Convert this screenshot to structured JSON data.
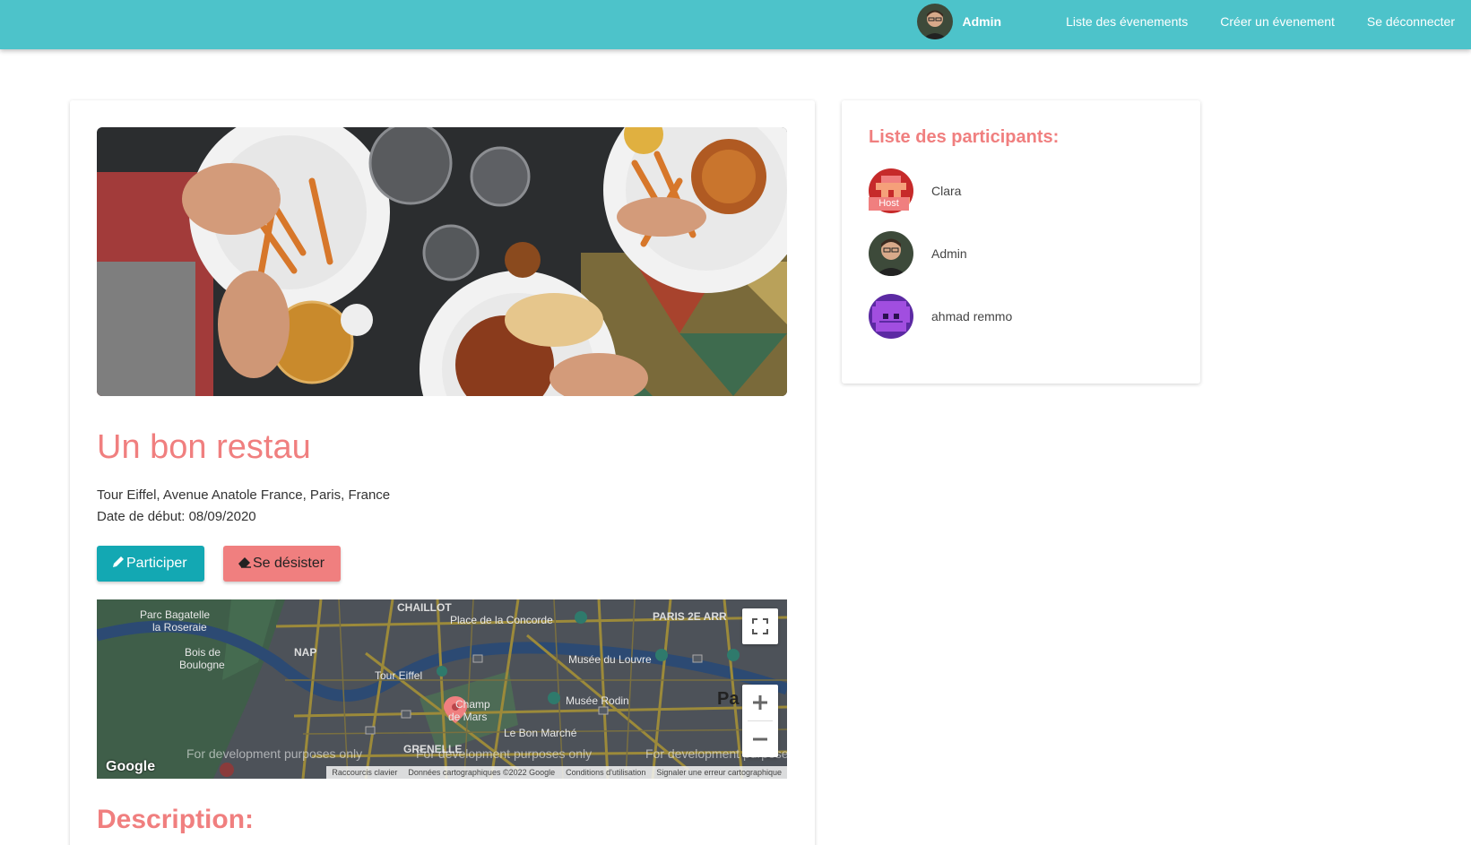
{
  "colors": {
    "navbar": "#4dc3ca",
    "accent": "#f07f7f",
    "participate_button": "#13a8b3",
    "withdraw_button": "#f07f7f"
  },
  "navbar": {
    "user_name": "Admin",
    "links": [
      "Liste des évenements",
      "Créer un évenement",
      "Se déconnecter"
    ]
  },
  "event": {
    "title": "Un bon restau",
    "address": "Tour Eiffel, Avenue Anatole France, Paris, France",
    "start_date": "Date de début: 08/09/2020",
    "participate_label": "Participer",
    "participate_icon": "pencil-icon",
    "withdraw_label": "Se désister",
    "withdraw_icon": "eraser-icon",
    "description_heading": "Description:"
  },
  "map": {
    "labels": {
      "chaillot": "CHAILLOT",
      "concorde": "Place de la Concorde",
      "paris2": "PARIS 2E ARR",
      "bagatelle1": "Parc Bagatelle",
      "bagatelle2": "la Roseraie",
      "bois1": "Bois de",
      "bois2": "Boulogne",
      "nap": "NAP",
      "louvre": "Musée du Louvre",
      "eiffel": "Tour Eiffel",
      "champ1": "Champ",
      "champ2": "de Mars",
      "rodin": "Musée Rodin",
      "bonmarche": "Le Bon Marché",
      "grenelle": "GRENELLE",
      "paris": "Pa"
    },
    "watermark": "For development purposes only",
    "google_logo": "Google",
    "footer": [
      "Raccourcis clavier",
      "Données cartographiques ©2022 Google",
      "Conditions d'utilisation",
      "Signaler une erreur cartographique"
    ]
  },
  "participants": {
    "title": "Liste des participants:",
    "host_badge": "Host",
    "list": [
      {
        "name": "Clara",
        "is_host": true
      },
      {
        "name": "Admin",
        "is_host": false
      },
      {
        "name": "ahmad remmo",
        "is_host": false
      }
    ]
  }
}
